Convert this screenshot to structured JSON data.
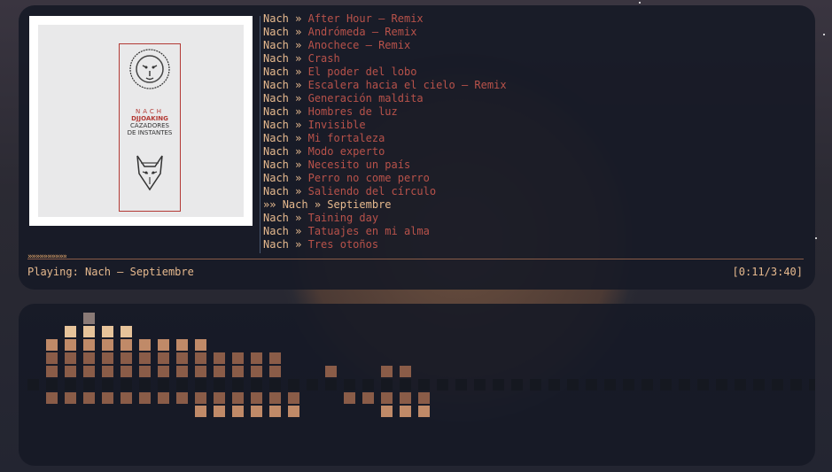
{
  "player": {
    "album": {
      "artist_line": "NACH",
      "feat_line": "DJJOAKING",
      "title_line1": "CAZADORES",
      "title_line2": "DE INSTANTES"
    },
    "separator": "»",
    "current_marker": "»»",
    "tracks": [
      {
        "artist": "Nach",
        "title": "After Hour – Remix"
      },
      {
        "artist": "Nach",
        "title": "Andrómeda – Remix"
      },
      {
        "artist": "Nach",
        "title": "Anochece – Remix"
      },
      {
        "artist": "Nach",
        "title": "Crash"
      },
      {
        "artist": "Nach",
        "title": "El poder del lobo"
      },
      {
        "artist": "Nach",
        "title": "Escalera hacia el cielo – Remix"
      },
      {
        "artist": "Nach",
        "title": "Generación maldita"
      },
      {
        "artist": "Nach",
        "title": "Hombres de luz"
      },
      {
        "artist": "Nach",
        "title": "Invisible"
      },
      {
        "artist": "Nach",
        "title": "Mi fortaleza"
      },
      {
        "artist": "Nach",
        "title": "Modo experto"
      },
      {
        "artist": "Nach",
        "title": "Necesito un país"
      },
      {
        "artist": "Nach",
        "title": "Perro no come perro"
      },
      {
        "artist": "Nach",
        "title": "Saliendo del círculo"
      },
      {
        "artist": "Nach",
        "title": "Septiembre",
        "current": true
      },
      {
        "artist": "Nach",
        "title": "Taining day"
      },
      {
        "artist": "Nach",
        "title": "Tatuajes en mi alma"
      },
      {
        "artist": "Nach",
        "title": "Tres otoños"
      }
    ],
    "progress_glyphs": "»»»»»»»»»»",
    "progress_fraction": 0.05,
    "status": "Playing: Nach – Septiembre",
    "time": "[0:11/3:40]"
  },
  "visualizer": {
    "colors": {
      "dark": "#151820",
      "mid": "#8a5c48",
      "light": "#c08a68",
      "bright": "#e6c39a",
      "gray": "#8a7a76"
    },
    "up_levels": [
      0,
      3,
      4,
      5,
      4,
      4,
      3,
      3,
      3,
      3,
      2,
      2,
      2,
      2,
      0,
      0,
      1,
      0,
      0,
      1,
      1,
      0,
      0,
      0,
      0,
      0,
      0,
      0,
      0,
      0,
      0,
      0,
      0,
      0,
      0,
      0,
      0,
      0,
      0,
      0,
      0,
      0,
      0
    ],
    "down_levels": [
      0,
      1,
      1,
      1,
      1,
      1,
      1,
      1,
      1,
      2,
      2,
      2,
      2,
      2,
      2,
      0,
      0,
      1,
      1,
      2,
      2,
      2,
      0,
      0,
      0,
      0,
      0,
      0,
      0,
      0,
      0,
      0,
      0,
      0,
      0,
      0,
      0,
      0,
      0,
      0,
      0,
      0,
      0
    ]
  }
}
